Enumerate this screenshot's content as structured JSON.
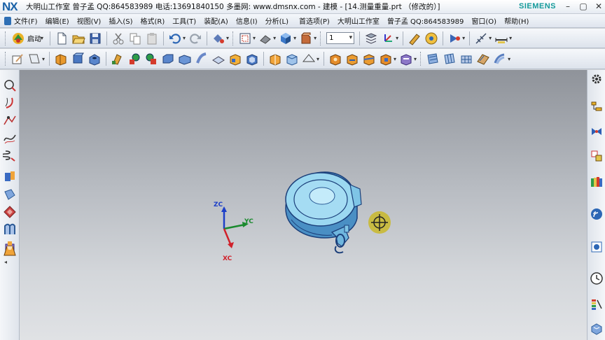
{
  "window": {
    "logo": "NX",
    "title": "大明山工作室 曾子孟 QQ:864583989 电话:13691840150 多墨网: www.dmsnx.com - 建模 - [14.测量重量.prt （修改的）]",
    "brand": "SIEMENS",
    "controls": [
      "–",
      "▢",
      "✕"
    ]
  },
  "menubar": {
    "left_items": [
      "文件(F)",
      "编辑(E)",
      "视图(V)",
      "插入(S)",
      "格式(R)",
      "工具(T)",
      "装配(A)",
      "信息(I)",
      "分析(L)"
    ],
    "right_items": [
      "首选项(P)",
      "大明山工作室",
      "曾子孟 QQ:864583989",
      "窗口(O)",
      "帮助(H)"
    ]
  },
  "toolbar1": {
    "start_label": "启动",
    "selection_filter_value": "1",
    "icons": [
      "start-icon",
      "new-file-icon",
      "open-folder-icon",
      "save-icon",
      "cut-icon",
      "copy-icon",
      "paste-icon",
      "undo-icon",
      "redo-icon",
      "command-finder-icon",
      "fit-view-icon",
      "render-style-icon",
      "shaded-cube-icon",
      "orient-view-icon",
      "layer-settings-icon",
      "wcs-icon",
      "snap-view-icon",
      "help-icon",
      "motion-icon",
      "dimension-icon",
      "measure-icon"
    ]
  },
  "toolbar2": {
    "icons": [
      "sketch-icon",
      "datum-plane-icon",
      "extrude-icon",
      "revolve-icon",
      "hole-icon",
      "boss-icon",
      "pocket-icon",
      "pad-icon",
      "slot-icon",
      "groove-icon",
      "sweep-icon",
      "thicken-icon",
      "offset-face-icon",
      "shell-icon",
      "edge-blend-icon",
      "chamfer-icon",
      "draft-icon",
      "face-blend-icon",
      "trim-body-icon",
      "split-body-icon",
      "unite-icon",
      "subtract-icon",
      "intersect-icon",
      "through-curves-icon",
      "surface-mesh-icon",
      "ruled-surface-icon",
      "bounded-plane-icon",
      "n-sided-surface-icon"
    ]
  },
  "left_sidebar": {
    "icons": [
      "circle-curve-icon",
      "arc-curve-icon",
      "line-curve-icon",
      "spline-icon",
      "helix-icon",
      "extrude-body-icon",
      "surface-patch-icon",
      "bend-face-icon",
      "through-mesh-icon",
      "box-feature-icon",
      "frustum-icon"
    ],
    "collapse": "◂"
  },
  "right_sidebar": {
    "icons": [
      "settings-gear-icon",
      "assembly-navigator-icon",
      "constraint-navigator-icon",
      "part-navigator-icon",
      "reuse-library-icon",
      "web-browser-icon",
      "history-icon",
      "clock-icon",
      "palette-icon",
      "system-materials-icon"
    ]
  },
  "viewport": {
    "triad": {
      "x_label": "XC",
      "y_label": "YC",
      "z_label": "ZC"
    },
    "colors": {
      "model": "#8fd2ee",
      "model_edge": "#1b3f7a",
      "x_axis": "#d0202a",
      "y_axis": "#1a8a2e",
      "z_axis": "#1d3fc8",
      "cursor": "#c9b92a"
    }
  }
}
